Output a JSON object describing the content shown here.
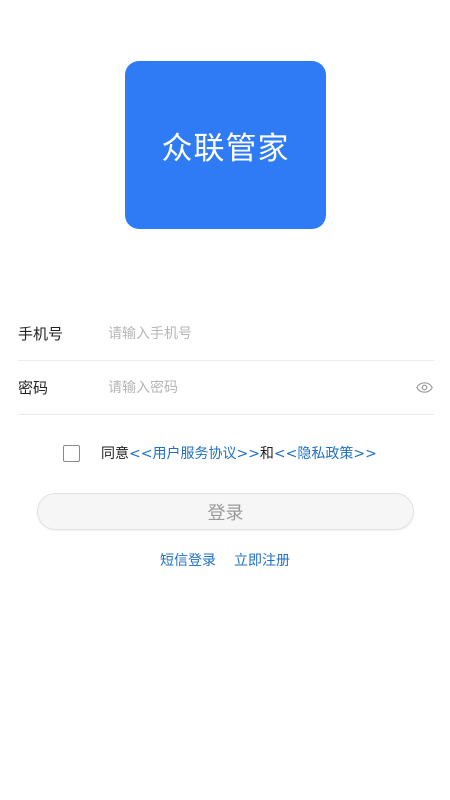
{
  "logo": {
    "text": "众联管家",
    "color": "#2f7bf6"
  },
  "form": {
    "phone": {
      "label": "手机号",
      "placeholder": "请输入手机号",
      "value": ""
    },
    "password": {
      "label": "密码",
      "placeholder": "请输入密码",
      "value": "",
      "toggle_icon": "eye-icon"
    }
  },
  "agreement": {
    "checked": false,
    "prefix": "同意",
    "user_agreement": "<<用户服务协议>>",
    "and": "和",
    "privacy_policy": "<<隐私政策>>",
    "link_color": "#1f6fc5"
  },
  "login_button": {
    "label": "登录"
  },
  "bottom_links": {
    "sms_login": "短信登录",
    "register": "立即注册"
  }
}
